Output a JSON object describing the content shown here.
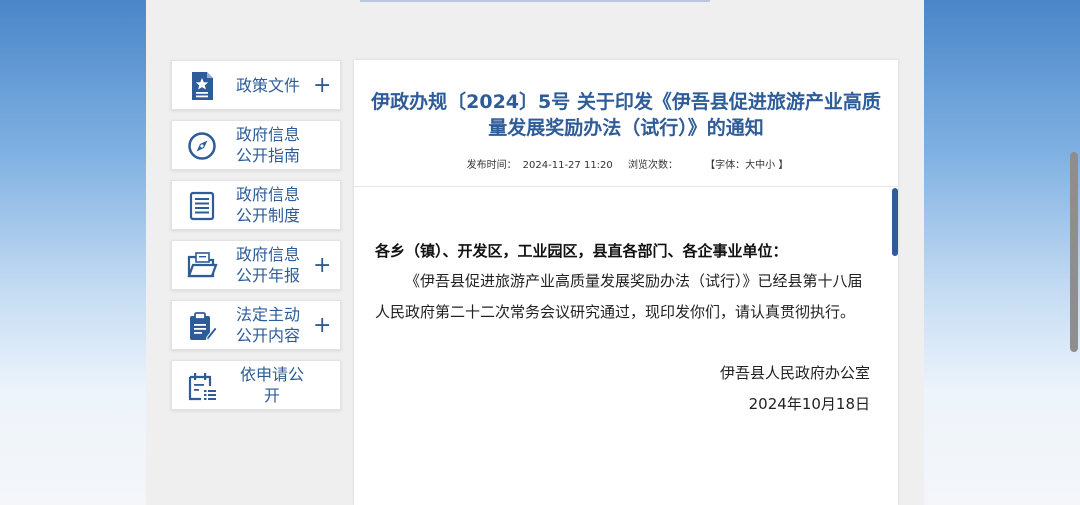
{
  "sidebar": {
    "items": [
      {
        "label": "政策文件",
        "icon": "document-star-icon",
        "expandable": true
      },
      {
        "label": "政府信息\n公开指南",
        "icon": "compass-icon",
        "expandable": false
      },
      {
        "label": "政府信息\n公开制度",
        "icon": "list-document-icon",
        "expandable": false
      },
      {
        "label": "政府信息\n公开年报",
        "icon": "folder-open-icon",
        "expandable": true
      },
      {
        "label": "法定主动\n公开内容",
        "icon": "clipboard-pen-icon",
        "expandable": true
      },
      {
        "label": "依申请公\n开",
        "icon": "calendar-list-icon",
        "expandable": false
      }
    ],
    "plus_symbol": "+"
  },
  "article": {
    "title": "伊政办规〔2024〕5号 关于印发《伊吾县促进旅游产业高质量发展奖励办法（试行）》的通知",
    "meta": {
      "publish_label": "发布时间：",
      "publish_time": "2024-11-27 11:20",
      "views_label": "浏览次数：",
      "views_count": "",
      "font_size": "【字体：大中小 】"
    },
    "greeting": "各乡（镇）、开发区，工业园区，县直各部门、各企事业单位：",
    "body": "《伊吾县促进旅游产业高质量发展奖励办法（试行）》已经县第十八届人民政府第二十二次常务会议研究通过，现印发你们，请认真贯彻执行。",
    "signature": "伊吾县人民政府办公室",
    "date": "2024年10月18日"
  },
  "colors": {
    "accent": "#2e5c98",
    "page_background": "#efefef"
  }
}
